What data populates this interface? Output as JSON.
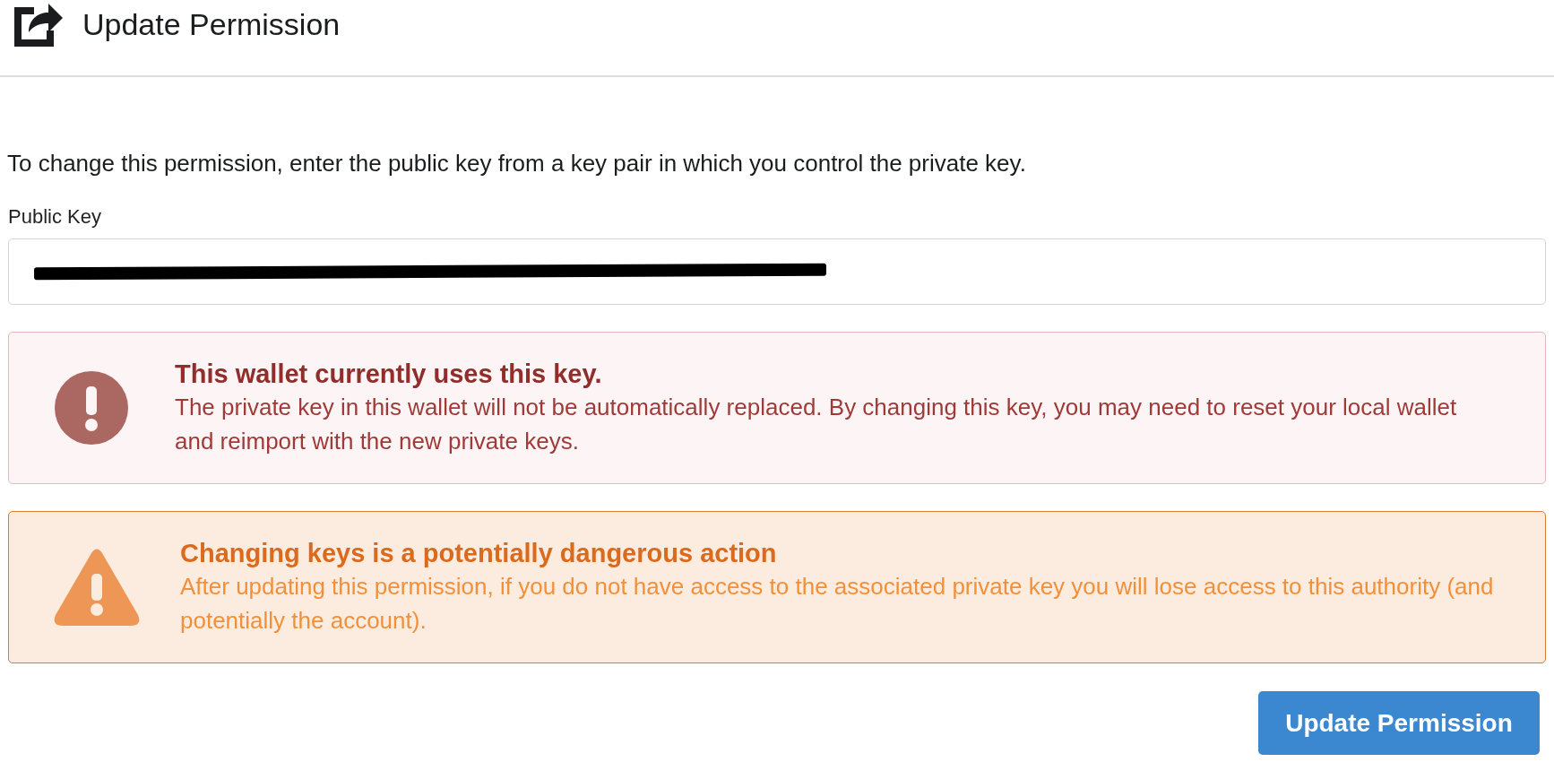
{
  "header": {
    "title": "Update Permission"
  },
  "intro": "To change this permission, enter the public key from a key pair in which you control the private key.",
  "public_key": {
    "label": "Public Key",
    "redacted": true
  },
  "messages": [
    {
      "kind": "error",
      "title": "This wallet currently uses this key.",
      "body": "The private key in this wallet will not be automatically replaced. By changing this key, you may need to reset your local wallet and reimport with the new private keys."
    },
    {
      "kind": "warning",
      "title": "Changing keys is a potentially dangerous action",
      "body": "After updating this permission, if you do not have access to the associated private key you will lose access to this authority (and potentially the account)."
    }
  ],
  "submit_button": "Update Permission"
}
